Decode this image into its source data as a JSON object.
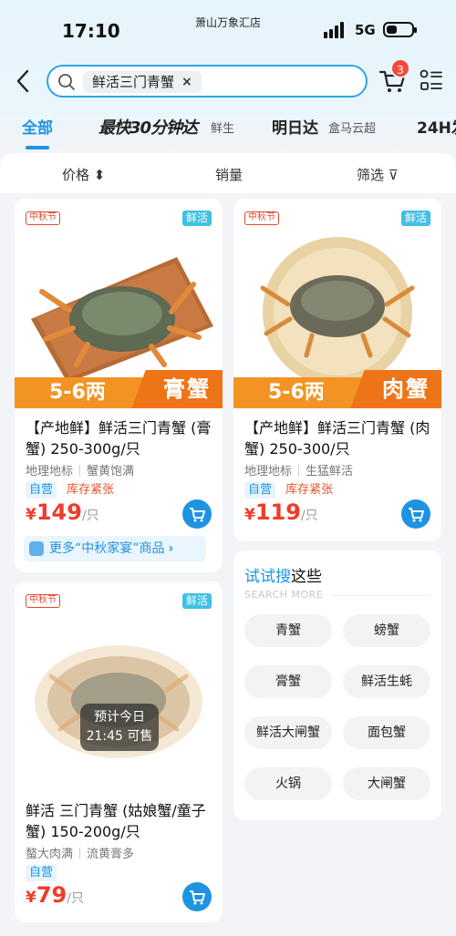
{
  "status": {
    "time": "17:10",
    "store": "萧山万象汇店",
    "network": "5G"
  },
  "search": {
    "query": "鲜活三门青蟹",
    "clear": "×"
  },
  "cart": {
    "badge": "3"
  },
  "tabs": {
    "all": "全部",
    "fast": "最快30分钟达",
    "fast_sub": "鲜生",
    "next_day": "明日达",
    "next_day_sub": "盒马云超",
    "h24": "24H发"
  },
  "filters": {
    "price": "价格 ⬍",
    "sales": "销量",
    "filter": "筛选 ⊽"
  },
  "products": [
    {
      "festival_tag": "中秋节",
      "fresh_tag": "鲜活",
      "spec": "5-6两",
      "type": "膏蟹",
      "title": "【产地鲜】鲜活三门青蟹 (膏蟹) 250-300g/只",
      "attr1": "地理地标",
      "attr2": "蟹黄饱满",
      "self_badge": "自营",
      "stock": "库存紧张",
      "currency": "¥",
      "price": "149",
      "unit": "/只",
      "promo": "更多“中秋家宴”商品"
    },
    {
      "festival_tag": "中秋节",
      "fresh_tag": "鲜活",
      "spec": "5-6两",
      "type": "肉蟹",
      "title": "【产地鲜】鲜活三门青蟹 (肉蟹) 250-300/只",
      "attr1": "地理地标",
      "attr2": "生猛鲜活",
      "self_badge": "自营",
      "stock": "库存紧张",
      "currency": "¥",
      "price": "119",
      "unit": "/只"
    },
    {
      "festival_tag": "中秋节",
      "fresh_tag": "鲜活",
      "eta_line1": "预计今日",
      "eta_line2": "21:45 可售",
      "title": "鲜活 三门青蟹 (姑娘蟹/童子蟹) 150-200g/只",
      "attr1": "螯大肉满",
      "attr2": "流黄膏多",
      "self_badge": "自营",
      "currency": "¥",
      "price": "79",
      "unit": "/只"
    }
  ],
  "suggest": {
    "title_hl": "试试搜",
    "title_rest": "这些",
    "subtitle": "SEARCH MORE",
    "chips": [
      "青蟹",
      "螃蟹",
      "膏蟹",
      "鲜活生蚝",
      "鲜活大闸蟹",
      "面包蟹",
      "火锅",
      "大闸蟹"
    ]
  },
  "colors": {
    "accent": "#1e93e2",
    "price": "#ef3c2a",
    "spec_orange": "#f39323",
    "fresh_tag": "#3fc0e4"
  }
}
